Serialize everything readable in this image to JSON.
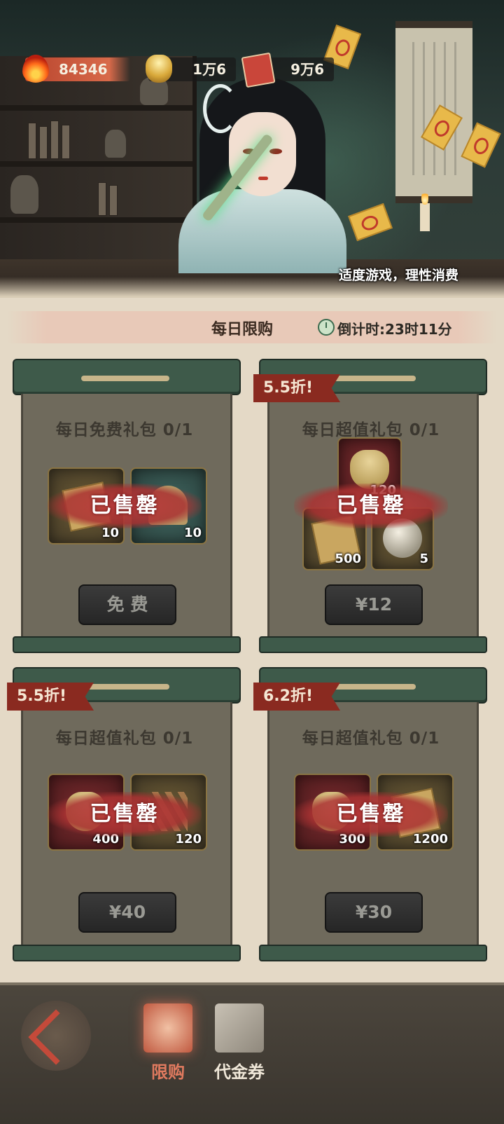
{
  "resources": {
    "fire": "84346",
    "ingot": "1万6",
    "ticket": "9万6"
  },
  "notice": "适度游戏，理性消费",
  "section": {
    "title": "每日限购",
    "countdown": "倒计时:23时11分"
  },
  "packs": [
    {
      "name": "每日免费礼包 0/1",
      "discount": "",
      "items": [
        {
          "icon": "talisman-icon",
          "qty": "10"
        },
        {
          "icon": "lotus-icon",
          "qty": "10"
        }
      ],
      "status": "已售罄",
      "price": "免 费"
    },
    {
      "name": "每日超值礼包 0/1",
      "discount": "5.5折!",
      "items": [
        {
          "icon": "yuanbao-icon",
          "qty": "120"
        },
        {
          "icon": "talisman-icon",
          "qty": "500"
        },
        {
          "icon": "pearl-icon",
          "qty": "5"
        }
      ],
      "status": "已售罄",
      "price": "¥12"
    },
    {
      "name": "每日超值礼包 0/1",
      "discount": "5.5折!",
      "items": [
        {
          "icon": "yuanbao-icon",
          "qty": "400"
        },
        {
          "icon": "incense-sticks-icon",
          "qty": "120"
        }
      ],
      "status": "已售罄",
      "price": "¥40"
    },
    {
      "name": "每日超值礼包 0/1",
      "discount": "6.2折!",
      "items": [
        {
          "icon": "yuanbao-icon",
          "qty": "300"
        },
        {
          "icon": "talisman-icon",
          "qty": "1200"
        }
      ],
      "status": "已售罄",
      "price": "¥30"
    }
  ],
  "nav": {
    "tabs": [
      {
        "label": "限购",
        "active": true
      },
      {
        "label": "代金券",
        "active": false
      }
    ]
  },
  "colors": {
    "accent": "#e07a5f",
    "panel": "#6f6a5c",
    "rod": "#3e5a4a",
    "discount": "#8a2a20"
  }
}
